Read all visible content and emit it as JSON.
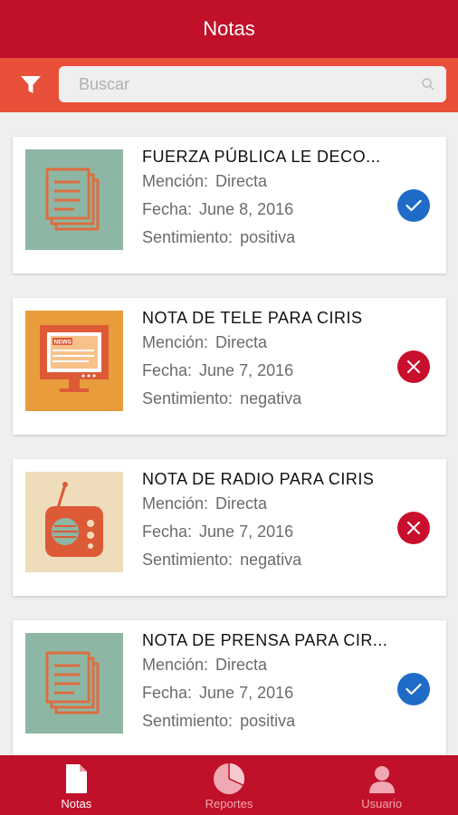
{
  "header": {
    "title": "Notas"
  },
  "search": {
    "placeholder": "Buscar",
    "value": ""
  },
  "notes": [
    {
      "title": "FUERZA PÚBLICA LE DECO...",
      "mencion_label": "Mención:",
      "mencion": "Directa",
      "fecha_label": "Fecha:",
      "fecha": "June 8, 2016",
      "sentimiento_label": "Sentimiento:",
      "sentimiento": "positiva",
      "media_icon": "document-stack-icon",
      "status_icon": "checkmark-icon"
    },
    {
      "title": "NOTA DE TELE PARA CIRIS",
      "mencion_label": "Mención:",
      "mencion": "Directa",
      "fecha_label": "Fecha:",
      "fecha": "June 7, 2016",
      "sentimiento_label": "Sentimiento:",
      "sentimiento": "negativa",
      "media_icon": "tv-monitor-icon",
      "status_icon": "x-mark-icon"
    },
    {
      "title": "NOTA DE RADIO PARA CIRIS",
      "mencion_label": "Mención:",
      "mencion": "Directa",
      "fecha_label": "Fecha:",
      "fecha": "June 7, 2016",
      "sentimiento_label": "Sentimiento:",
      "sentimiento": "negativa",
      "media_icon": "radio-icon",
      "status_icon": "x-mark-icon"
    },
    {
      "title": "NOTA DE PRENSA PARA CIR...",
      "mencion_label": "Mención:",
      "mencion": "Directa",
      "fecha_label": "Fecha:",
      "fecha": "June 7, 2016",
      "sentimiento_label": "Sentimiento:",
      "sentimiento": "positiva",
      "media_icon": "document-stack-icon",
      "status_icon": "checkmark-icon"
    }
  ],
  "tabs": [
    {
      "label": "Notas",
      "icon": "document-icon",
      "active": true
    },
    {
      "label": "Reportes",
      "icon": "pie-chart-icon",
      "active": false
    },
    {
      "label": "Usuario",
      "icon": "user-icon",
      "active": false
    }
  ],
  "colors": {
    "brand": "#c0102a",
    "search_bar": "#e8503a",
    "positive": "#1e6cc8",
    "negative": "#c8102e",
    "background": "#efefef"
  },
  "newsprint_text": "NEWS"
}
